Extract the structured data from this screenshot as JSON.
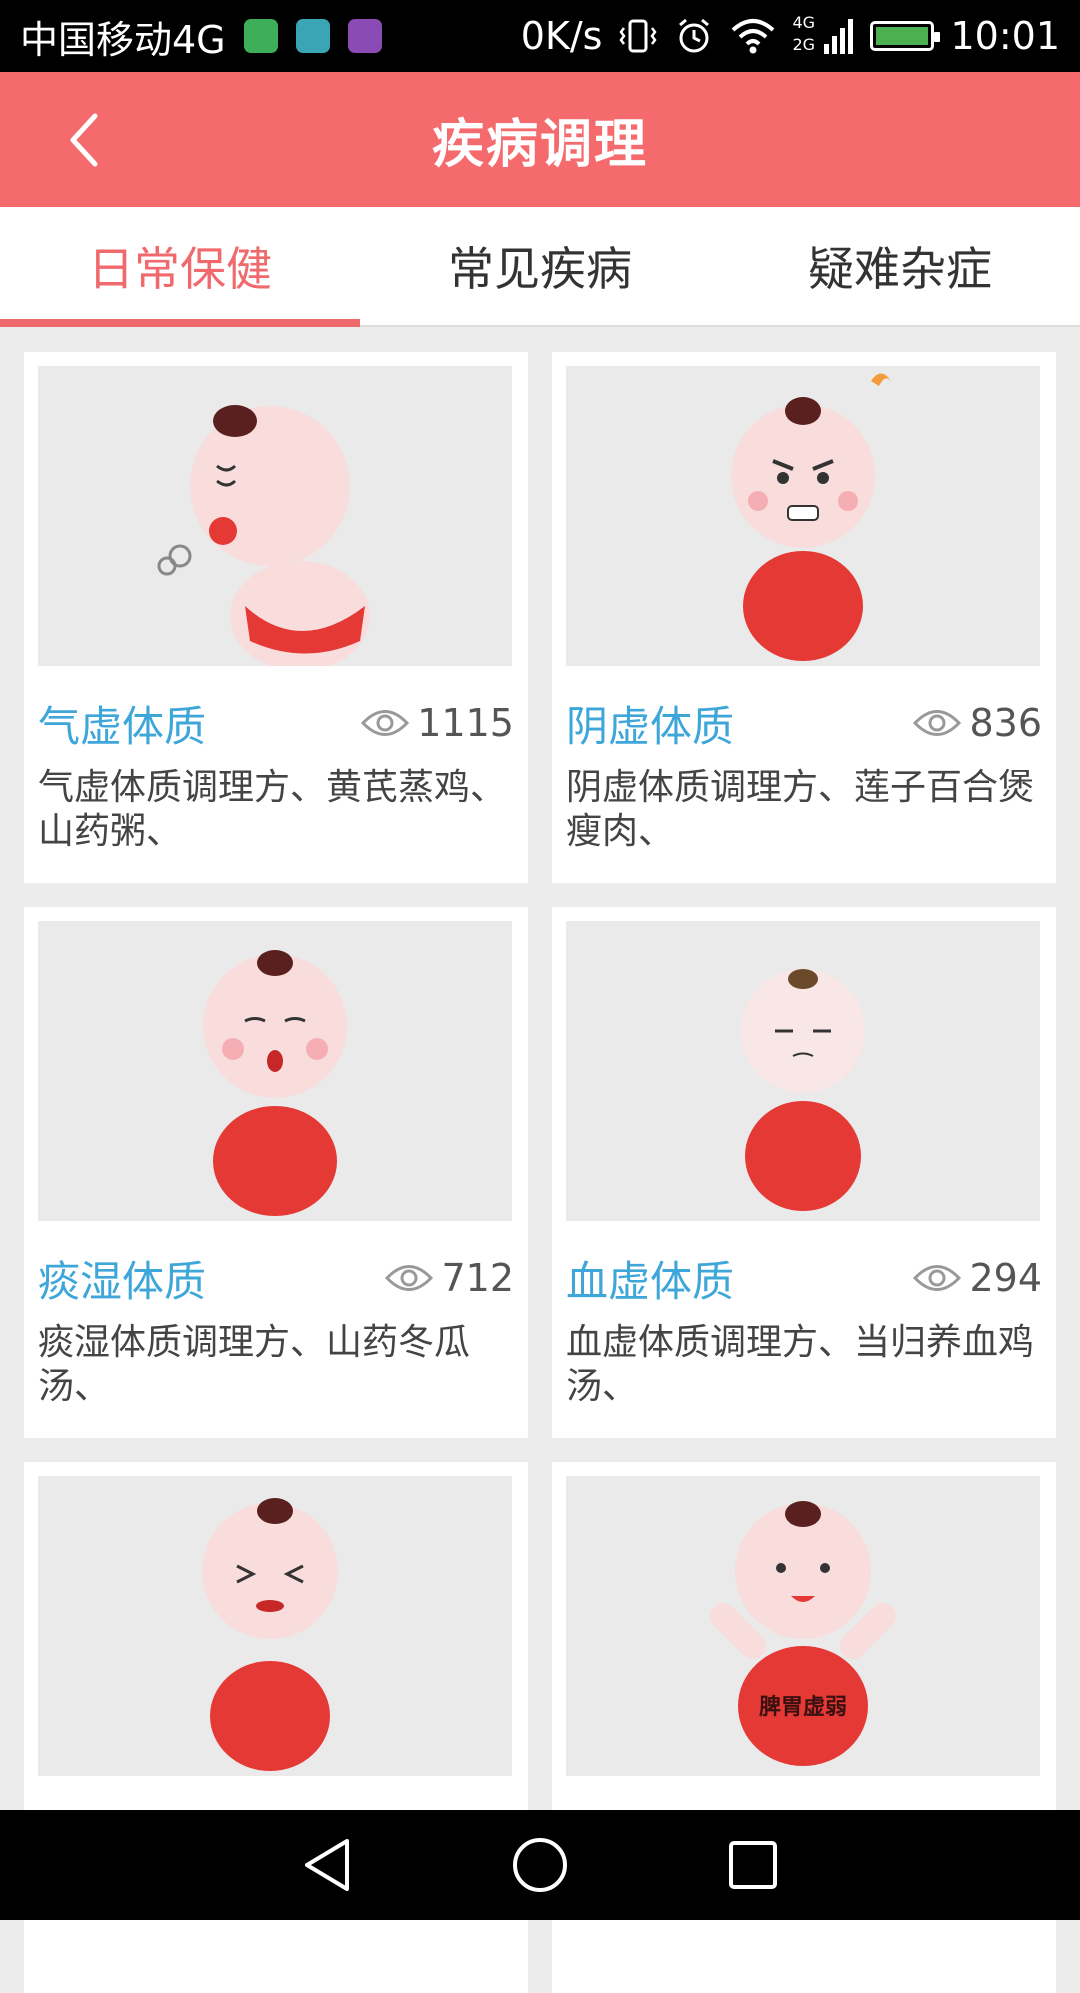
{
  "status_bar": {
    "carrier": "中国移动4G",
    "net_speed": "0K/s",
    "network_label_top": "4G",
    "network_label_bottom": "2G",
    "time": "10:01",
    "app_icon_colors": [
      "#3fae5a",
      "#3aa6b5",
      "#8a4bb5"
    ],
    "battery_color": "#4caf50"
  },
  "header": {
    "title": "疾病调理",
    "back_icon": "chevron-left-icon",
    "background": "#f56a6d"
  },
  "tabs": [
    {
      "label": "日常保健",
      "active": true
    },
    {
      "label": "常见疾病",
      "active": false
    },
    {
      "label": "疑难杂症",
      "active": false
    }
  ],
  "cards": [
    {
      "title": "气虚体质",
      "views": "1115",
      "desc": "气虚体质调理方、黄芪蒸鸡、山药粥、"
    },
    {
      "title": "阴虚体质",
      "views": "836",
      "desc": "阴虚体质调理方、莲子百合煲瘦肉、"
    },
    {
      "title": "痰湿体质",
      "views": "712",
      "desc": "痰湿体质调理方、山药冬瓜汤、"
    },
    {
      "title": "血虚体质",
      "views": "294",
      "desc": "血虚体质调理方、当归养血鸡汤、"
    },
    {
      "title": "",
      "views": "",
      "desc": ""
    },
    {
      "title": "",
      "views": "",
      "desc": "",
      "belly_text": "脾胃虚弱"
    }
  ],
  "colors": {
    "accent": "#f06a6d",
    "card_title": "#3fa6d9",
    "belly_red": "#e53935",
    "skin": "#f9dcdc"
  }
}
